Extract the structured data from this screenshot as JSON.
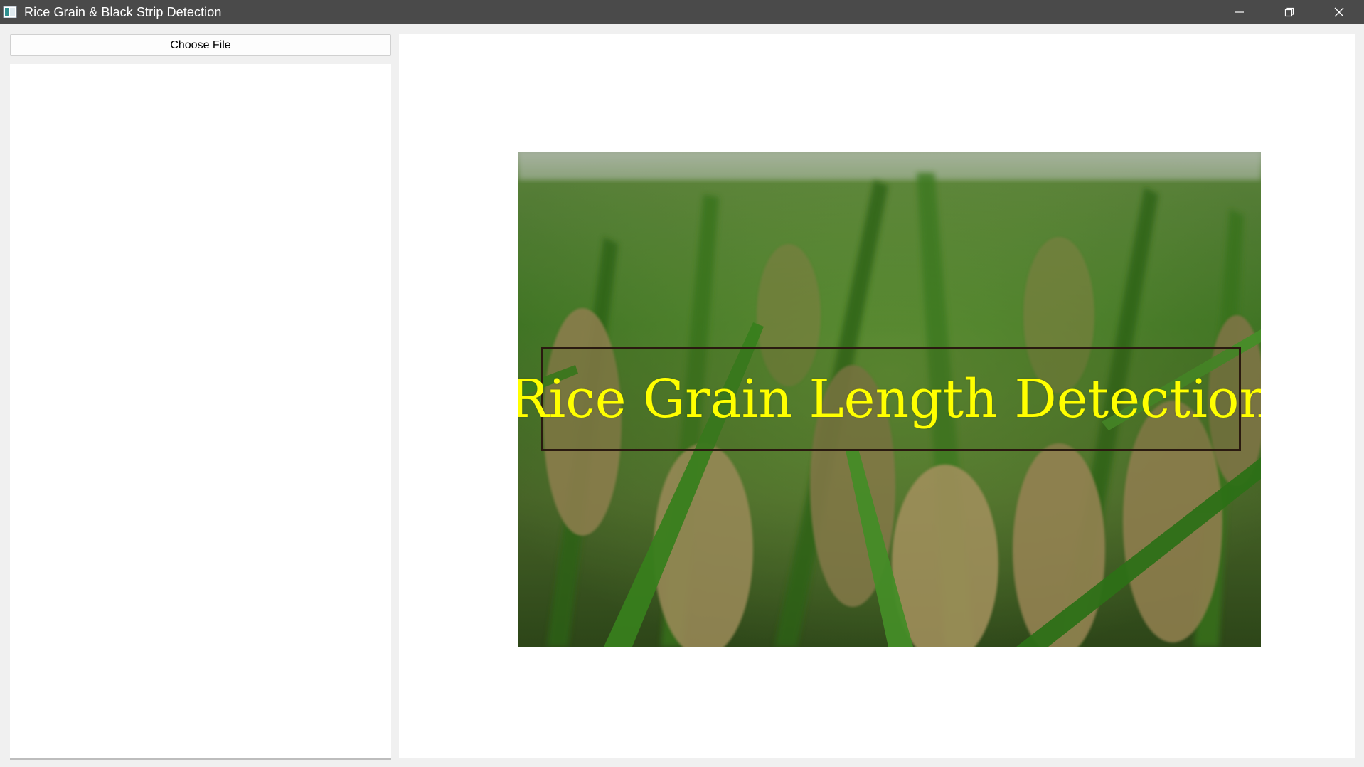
{
  "window": {
    "title": "Rice Grain & Black Strip Detection",
    "controls": [
      "minimize",
      "restore",
      "close"
    ]
  },
  "left_panel": {
    "choose_file_label": "Choose File"
  },
  "right_panel": {
    "banner": {
      "title": "Rice Grain Length Detection"
    }
  },
  "colors": {
    "titlebar": "#4a4a4a",
    "banner_text": "#ffff00",
    "banner_frame": "#2a1a10",
    "panel_background": "#ffffff",
    "window_background": "#f0f0f0"
  }
}
